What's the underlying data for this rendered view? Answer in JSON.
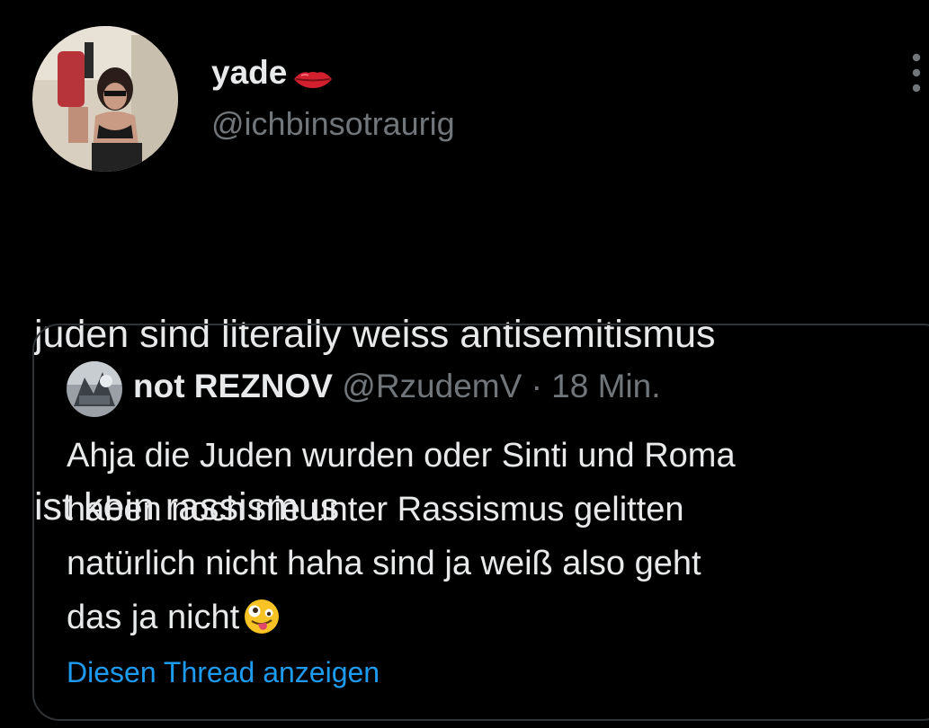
{
  "tweet": {
    "display_name": "yade",
    "name_emoji_icon": "lips-icon",
    "handle": "@ichbinsotraurig",
    "more_icon": "more-vertical-icon",
    "text_line1": "juden sind literally weiss antisemitismus",
    "text_line2": "ist kein rassismus"
  },
  "quote": {
    "display_name": "not REZNOV",
    "handle": "@RzudemV",
    "separator": "·",
    "time": "18 Min.",
    "text_line1": "Ahja die Juden wurden oder Sinti und Roma",
    "text_line2": "haben noch nie unter Rassismus gelitten",
    "text_line3": "natürlich nicht haha sind ja weiß also geht",
    "text_line4": "das ja nicht",
    "emoji_icon": "zany-face-icon",
    "show_thread_label": "Diesen Thread anzeigen"
  },
  "colors": {
    "background": "#000000",
    "text_primary": "#e7e9ea",
    "text_secondary": "#71767b",
    "link": "#1d9bf0",
    "border": "#2f3336"
  }
}
